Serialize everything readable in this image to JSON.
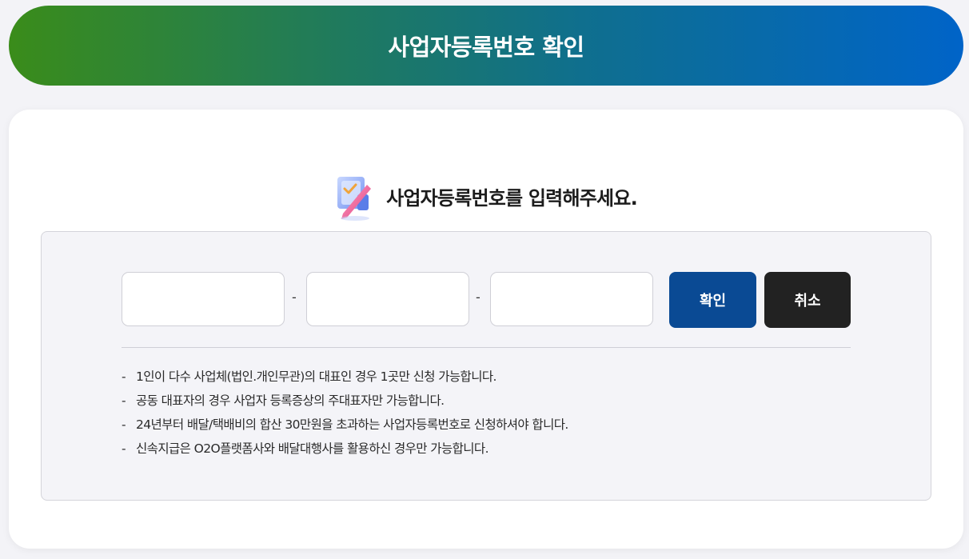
{
  "header": {
    "title": "사업자등록번호 확인"
  },
  "form": {
    "heading": "사업자등록번호를 입력해주세요.",
    "separator": "-",
    "confirm_label": "확인",
    "cancel_label": "취소",
    "fields": [
      {
        "value": "",
        "placeholder": ""
      },
      {
        "value": "",
        "placeholder": ""
      },
      {
        "value": "",
        "placeholder": ""
      }
    ]
  },
  "notes": {
    "bullet": "-",
    "items": [
      "1인이 다수 사업체(법인.개인무관)의 대표인 경우 1곳만 신청 가능합니다.",
      "공동 대표자의 경우 사업자 등록증상의 주대표자만 가능합니다.",
      "24년부터 배달/택배비의 합산 30만원을 초과하는 사업자등록번호로 신청하셔야 합니다.",
      "신속지급은 O2O플랫폼사와 배달대행사를 활용하신 경우만 가능합니다."
    ]
  },
  "icons": {
    "heading_icon": "checklist-pencil-icon"
  },
  "colors": {
    "banner_start": "#3a8c1a",
    "banner_end": "#0064c8",
    "confirm_button": "#0a4a94",
    "cancel_button": "#222222"
  }
}
